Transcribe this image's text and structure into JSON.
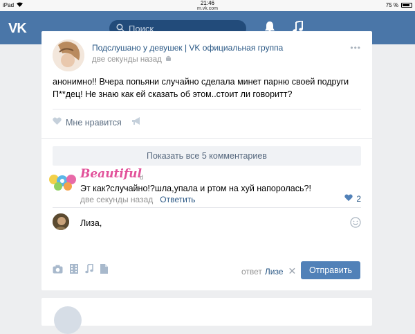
{
  "status_bar": {
    "device": "iPad",
    "time": "21:46",
    "url": "m.vk.com",
    "battery": "75 %"
  },
  "header": {
    "logo": "VK",
    "search_placeholder": "Поиск",
    "notifications_icon": "bell-icon",
    "music_icon": "music-note-icon"
  },
  "post": {
    "group_name": "Подслушано у девушек | VK официальная группа",
    "time": "две секунды назад",
    "text": "анонимно!! Вчера попьяни случайно сделала минет парню своей подруги П**дец! Не знаю как ей сказать об этом..стоит ли говоритт?",
    "like_label": "Мне нравится",
    "show_comments": "Показать все 5 комментариев"
  },
  "comment": {
    "author_display": "Beautiful",
    "author_tail": "d",
    "text": "Эт как?случайно!?шла,упала и ртом на хуй напоролась?!",
    "time": "две секунды назад",
    "reply_label": "Ответить",
    "likes": "2"
  },
  "reply_box": {
    "value": "Лиза,",
    "reply_to_prefix": "ответ",
    "reply_to_name": "Лизе",
    "send_label": "Отправить"
  },
  "colors": {
    "header": "#4a76a8",
    "link": "#2a5885",
    "button": "#5181b8",
    "background": "#edeef0"
  }
}
